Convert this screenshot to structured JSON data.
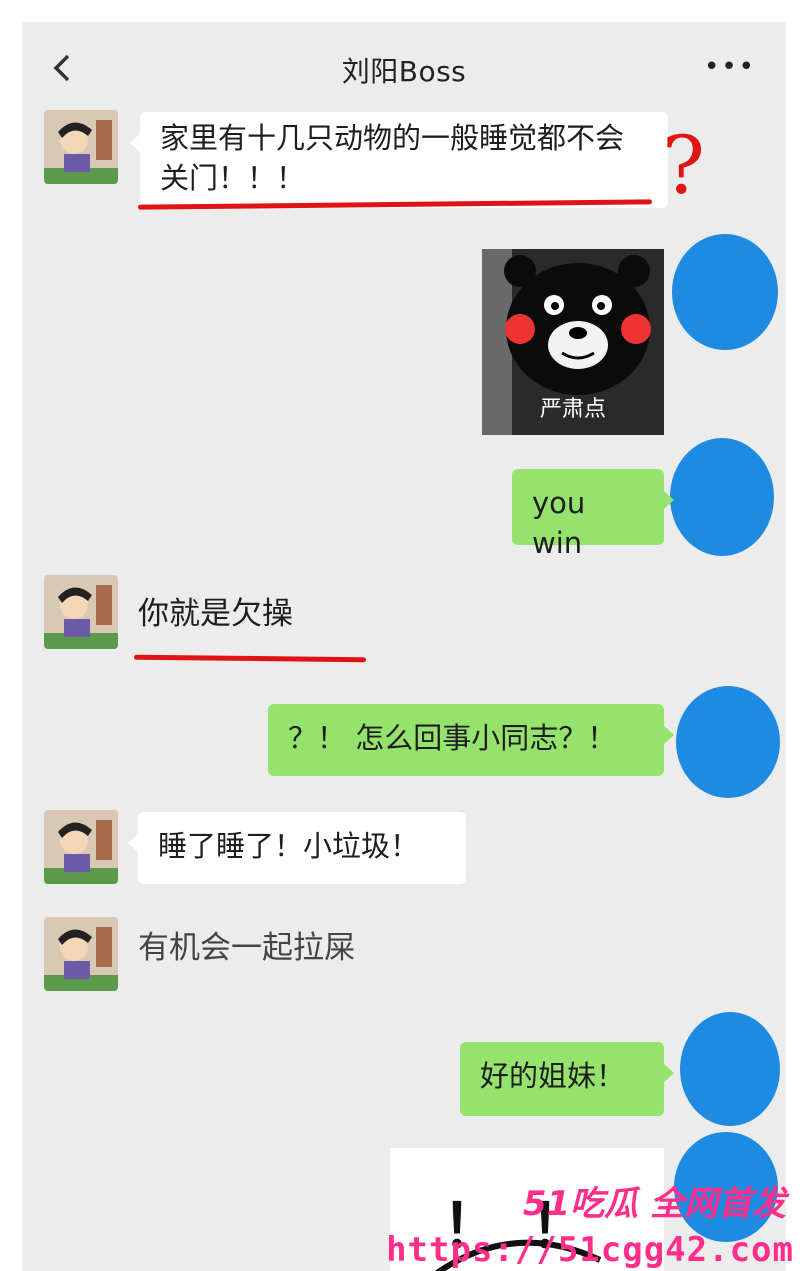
{
  "header": {
    "back_icon": "chevron-left-icon",
    "title": "刘阳Boss",
    "more_label": "•••"
  },
  "messages": [
    {
      "side": "in",
      "text": "家里有十几只动物的一般睡觉都不会关门！！！"
    },
    {
      "side": "out",
      "type": "sticker",
      "caption": "严肃点"
    },
    {
      "side": "out",
      "text": "you win"
    },
    {
      "side": "in",
      "text": "你就是欠操"
    },
    {
      "side": "out",
      "text": "？！ 怎么回事小同志？！"
    },
    {
      "side": "in",
      "text": "睡了睡了！小垃圾！"
    },
    {
      "side": "in",
      "text": "有机会一起拉屎"
    },
    {
      "side": "out",
      "text": "好的姐妹！"
    },
    {
      "side": "out",
      "type": "sticker",
      "caption": "！！"
    }
  ],
  "annotations": {
    "question_mark": "?",
    "color": "#e01414"
  },
  "watermark": {
    "line1": "51吃瓜 全网首发",
    "line2": "https://51cgg42.com"
  },
  "colors": {
    "outgoing_bubble": "#95e26d",
    "incoming_bubble": "#ffffff",
    "background": "#ececec",
    "avatar_mask": "#1f8ae2"
  }
}
